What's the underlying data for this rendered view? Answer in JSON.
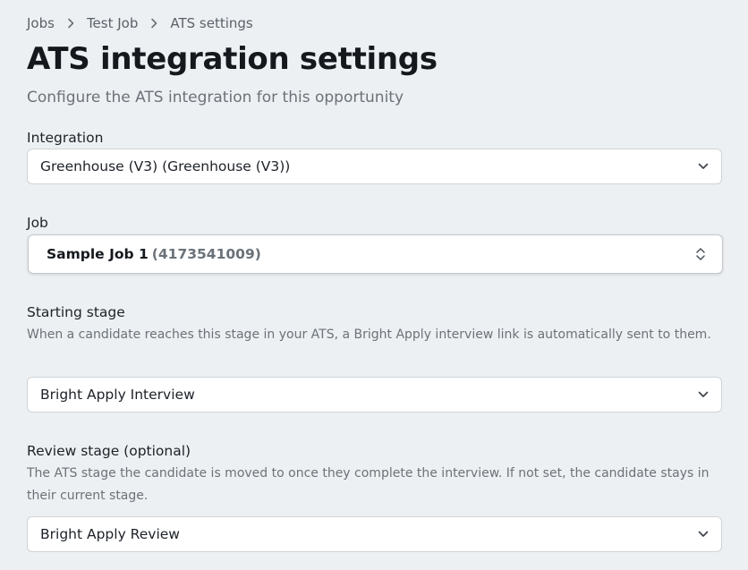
{
  "breadcrumb": {
    "items": [
      "Jobs",
      "Test Job",
      "ATS settings"
    ]
  },
  "page": {
    "title": "ATS integration settings",
    "subtitle": "Configure the ATS integration for this opportunity"
  },
  "integration": {
    "label": "Integration",
    "value": "Greenhouse (V3) (Greenhouse (V3))"
  },
  "job": {
    "label": "Job",
    "name": "Sample Job 1",
    "id": "(4173541009)"
  },
  "starting_stage": {
    "label": "Starting stage",
    "help": "When a candidate reaches this stage in your ATS, a Bright Apply interview link is automatically sent to them.",
    "value": "Bright Apply Interview"
  },
  "review_stage": {
    "label": "Review stage (optional)",
    "help": "The ATS stage the candidate is moved to once they complete the interview. If not set, the candidate stays in their current stage.",
    "value": "Bright Apply Review"
  },
  "icons": {
    "separator": "chevron-right-icon",
    "dropdown": "chevron-down-icon",
    "combo": "up-down-chevron-icon"
  }
}
